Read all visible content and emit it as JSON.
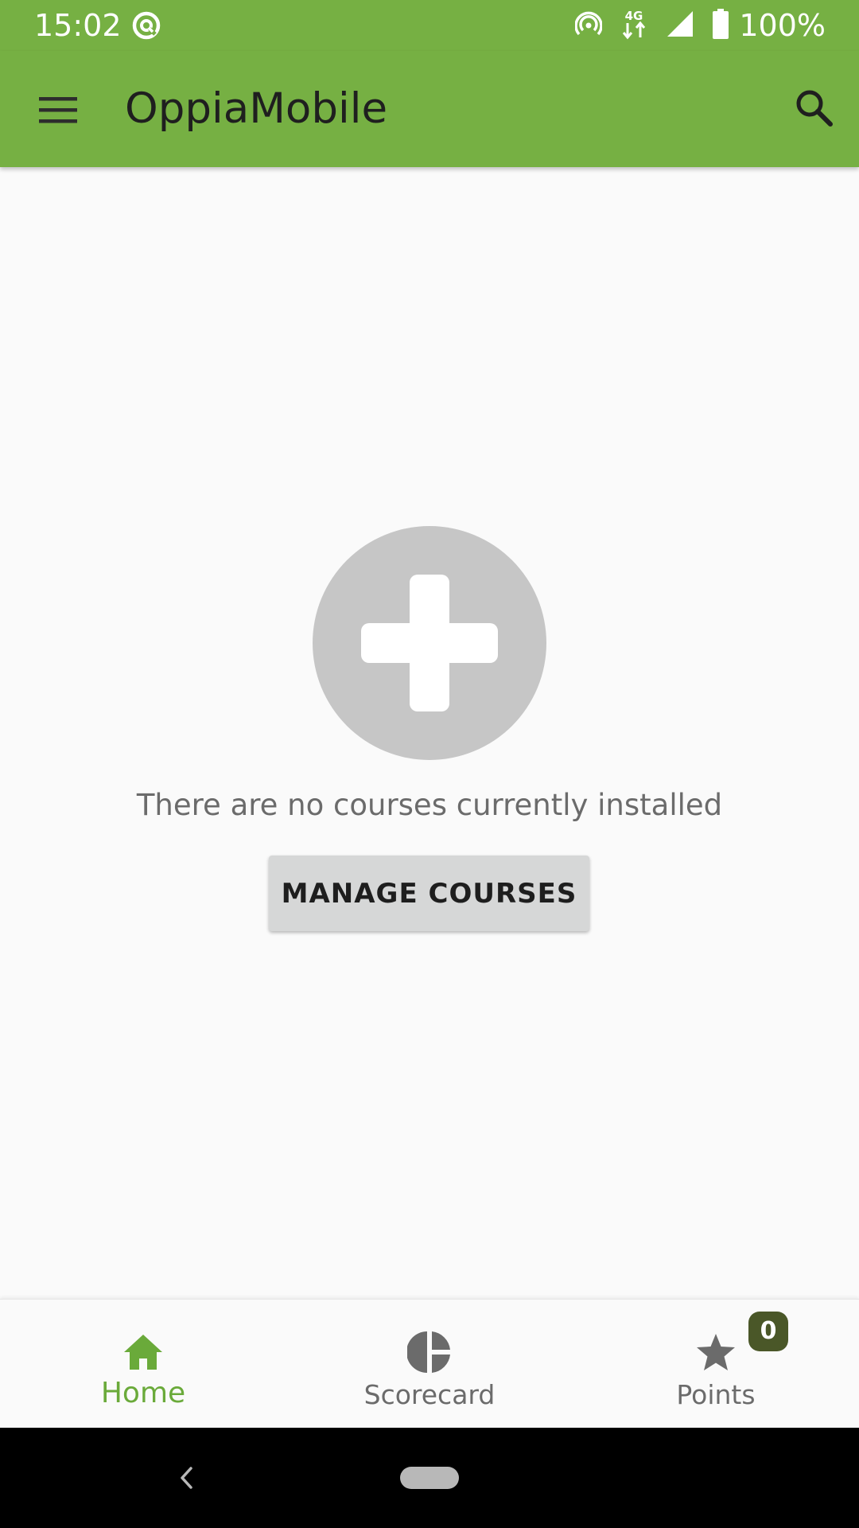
{
  "status_bar": {
    "time": "15:02",
    "battery_percent": "100%",
    "network_type": "4G",
    "icons": [
      "app-notification-icon",
      "hotspot-icon",
      "mobile-data-icon",
      "cell-signal-icon",
      "battery-icon"
    ]
  },
  "app_bar": {
    "title": "OppiaMobile",
    "left_icon": "menu-icon",
    "right_icon": "search-icon",
    "color": "#76b043"
  },
  "main": {
    "illustration_icon": "add-circle-icon",
    "empty_message": "There are no courses currently installed",
    "manage_button_label": "MANAGE COURSES"
  },
  "bottom_nav": {
    "items": [
      {
        "label": "Home",
        "icon": "home-icon",
        "active": true
      },
      {
        "label": "Scorecard",
        "icon": "pie-chart-icon",
        "active": false
      },
      {
        "label": "Points",
        "icon": "star-icon",
        "active": false,
        "badge": "0"
      }
    ],
    "active_color": "#6aaa3a",
    "inactive_color": "#6b6b6b",
    "badge_color": "#4a5728"
  },
  "system_nav": {
    "icons": [
      "back-icon",
      "home-pill-icon"
    ]
  }
}
